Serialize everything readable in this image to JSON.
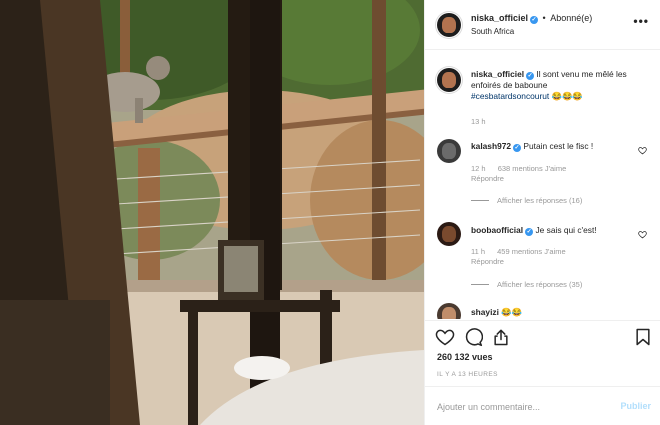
{
  "header": {
    "username": "niska_officiel",
    "follow_label": "Abonné(e)",
    "dot": "•",
    "location": "South Africa",
    "more_icon": "more-horizontal-icon",
    "more_glyph": "•••"
  },
  "caption": {
    "username": "niska_officiel",
    "text": " Il sont venu me mêlé les enfoirés de baboune ",
    "hashtag": "#cesbatardsoncourut",
    "emojis": "😂😂😂",
    "time": "13 h"
  },
  "comments": [
    {
      "username": "kalash972",
      "text": "Putain cest le fisc !",
      "time": "12 h",
      "likes": "638 mentions J'aime",
      "reply_label": "Répondre",
      "replies_label": "Afficher les réponses (16)"
    },
    {
      "username": "boobaofficial",
      "text": "Je sais qui c'est!",
      "time": "11 h",
      "likes": "459 mentions J'aime",
      "reply_label": "Répondre",
      "replies_label": "Afficher les réponses (35)"
    },
    {
      "username": "shayizi",
      "text": "😂😂"
    }
  ],
  "actions": {
    "like_icon": "heart-icon",
    "comment_icon": "comment-icon",
    "share_icon": "share-icon",
    "save_icon": "bookmark-icon",
    "views": "260 132 vues",
    "time_ago": "IL Y A 13 HEURES"
  },
  "add_comment": {
    "placeholder": "Ajouter un commentaire...",
    "post_label": "Publier"
  },
  "colors": {
    "link_blue": "#003569",
    "verified_blue": "#3897f0",
    "muted": "#999999",
    "post_disabled": "#b2dffc"
  }
}
